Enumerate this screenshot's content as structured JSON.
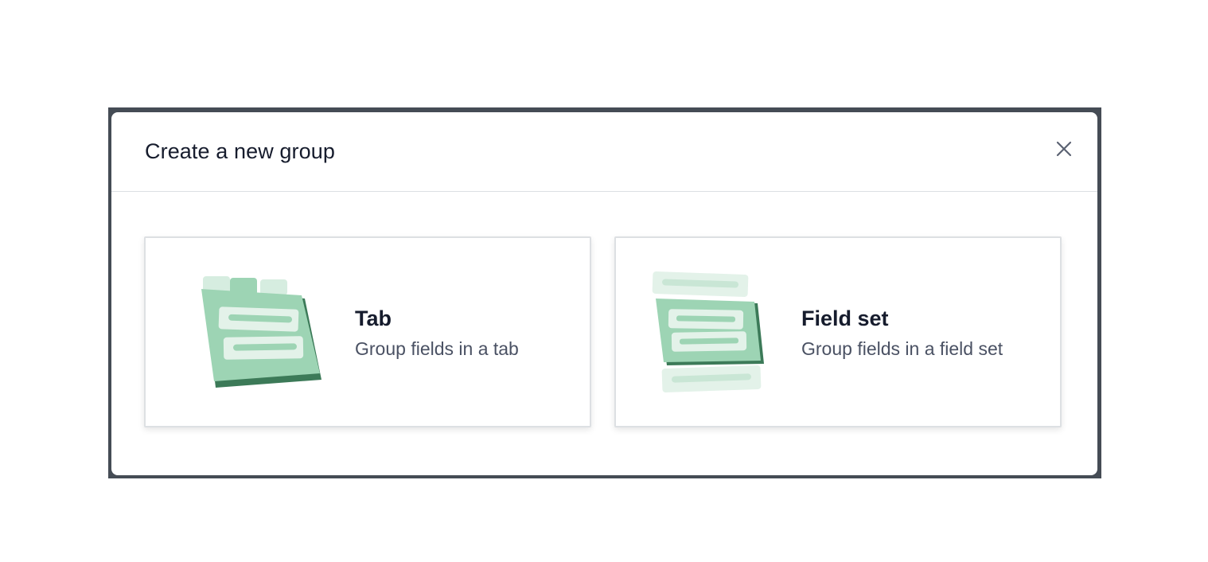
{
  "modal": {
    "title": "Create a new group",
    "close_icon": "close-icon"
  },
  "options": [
    {
      "title": "Tab",
      "description": "Group fields in a tab",
      "icon": "tab-illustration-icon"
    },
    {
      "title": "Field set",
      "description": "Group fields in a field set",
      "icon": "fieldset-illustration-icon"
    }
  ],
  "colors": {
    "overlay": "#454c55",
    "illustration_green": "#9dd4b4",
    "illustration_dark_green": "#3c7a58",
    "illustration_light": "#e3f2e9",
    "text_primary": "#161c2d",
    "text_secondary": "#4a5163"
  }
}
